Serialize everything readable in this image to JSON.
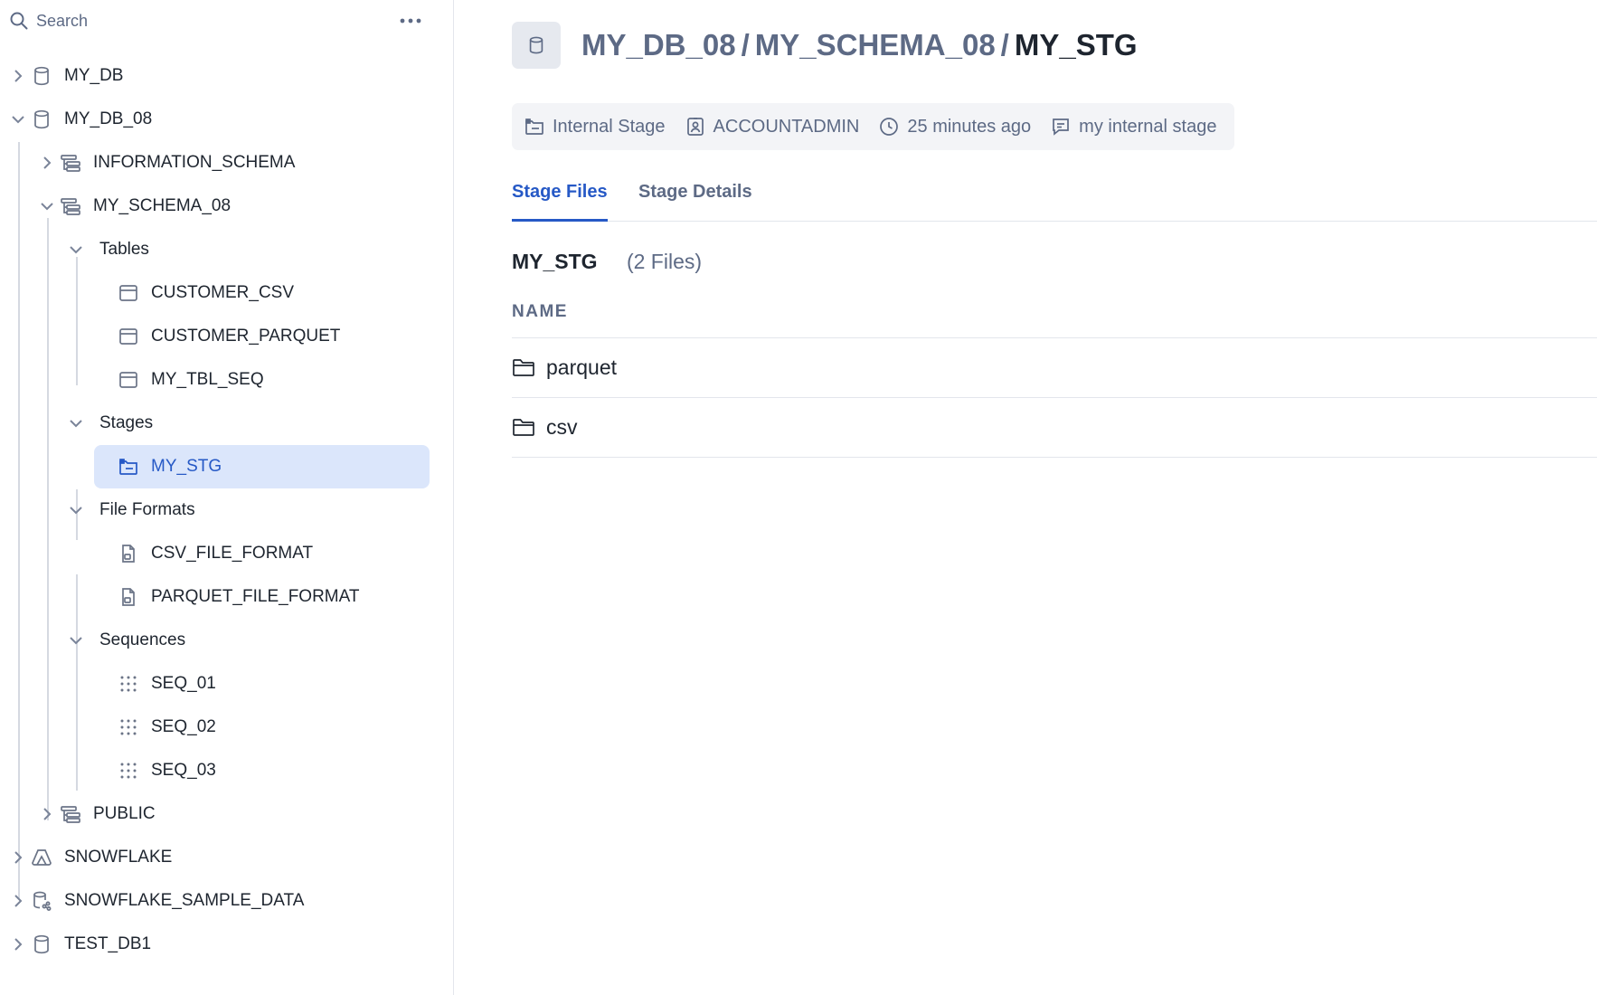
{
  "sidebar": {
    "search": {
      "placeholder": "Search",
      "value": ""
    },
    "more_label": "more options",
    "tree": [
      {
        "label": "MY_DB",
        "icon": "database-icon",
        "expanded": false
      },
      {
        "label": "MY_DB_08",
        "icon": "database-icon",
        "expanded": true
      },
      {
        "label": "INFORMATION_SCHEMA",
        "icon": "schema-icon",
        "expanded": false
      },
      {
        "label": "MY_SCHEMA_08",
        "icon": "schema-icon",
        "expanded": true
      },
      {
        "label": "Tables",
        "icon": "",
        "expanded": true
      },
      {
        "label": "CUSTOMER_CSV",
        "icon": "table-icon"
      },
      {
        "label": "CUSTOMER_PARQUET",
        "icon": "table-icon"
      },
      {
        "label": "MY_TBL_SEQ",
        "icon": "table-icon"
      },
      {
        "label": "Stages",
        "icon": "",
        "expanded": true
      },
      {
        "label": "MY_STG",
        "icon": "stage-icon",
        "selected": true
      },
      {
        "label": "File Formats",
        "icon": "",
        "expanded": true
      },
      {
        "label": "CSV_FILE_FORMAT",
        "icon": "file-format-icon"
      },
      {
        "label": "PARQUET_FILE_FORMAT",
        "icon": "file-format-icon"
      },
      {
        "label": "Sequences",
        "icon": "",
        "expanded": true
      },
      {
        "label": "SEQ_01",
        "icon": "sequence-icon"
      },
      {
        "label": "SEQ_02",
        "icon": "sequence-icon"
      },
      {
        "label": "SEQ_03",
        "icon": "sequence-icon"
      },
      {
        "label": "PUBLIC",
        "icon": "schema-icon",
        "expanded": false
      },
      {
        "label": "SNOWFLAKE",
        "icon": "snowflake-app-icon",
        "expanded": false
      },
      {
        "label": "SNOWFLAKE_SAMPLE_DATA",
        "icon": "shared-database-icon",
        "expanded": false
      },
      {
        "label": "TEST_DB1",
        "icon": "database-icon",
        "expanded": false
      }
    ]
  },
  "header": {
    "icon": "database-icon",
    "breadcrumb": {
      "db": "MY_DB_08",
      "schema": "MY_SCHEMA_08",
      "current": "MY_STG",
      "separator": "/"
    }
  },
  "meta": {
    "type": "Internal Stage",
    "owner": "ACCOUNTADMIN",
    "modified": "25 minutes ago",
    "comment": "my internal stage"
  },
  "tabs": [
    {
      "label": "Stage Files",
      "active": true
    },
    {
      "label": "Stage Details",
      "active": false
    }
  ],
  "files": {
    "title": "MY_STG",
    "count": "(2 Files)",
    "column_header": "NAME",
    "rows": [
      {
        "name": "parquet",
        "icon": "folder-icon"
      },
      {
        "name": "csv",
        "icon": "folder-icon"
      }
    ]
  },
  "colors": {
    "accent": "#2659c6",
    "selected_bg": "#dbe6fb",
    "muted_text": "#5d6a85",
    "text": "#1e252f"
  }
}
